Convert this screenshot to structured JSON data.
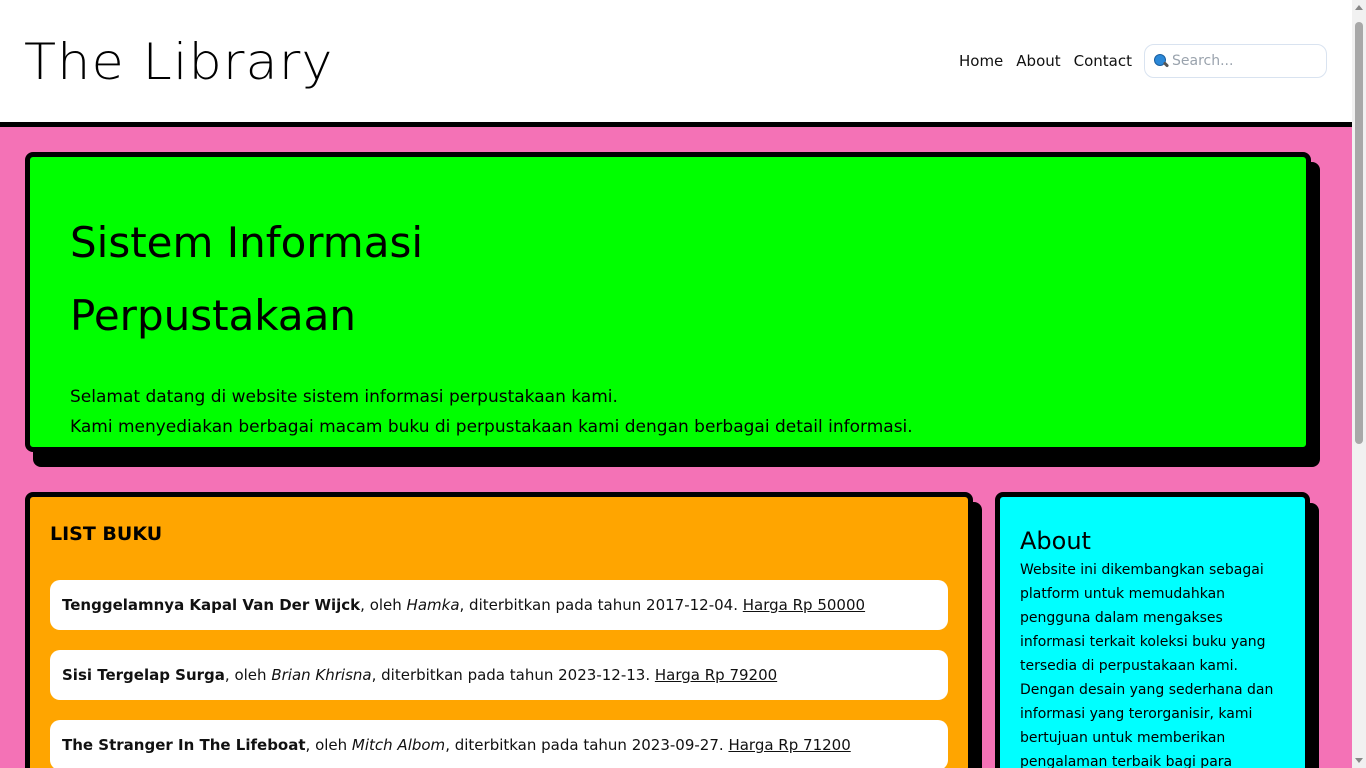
{
  "header": {
    "logo": "The Library",
    "nav": [
      "Home",
      "About",
      "Contact"
    ],
    "search_placeholder": "Search..."
  },
  "hero": {
    "title_line1": "Sistem Informasi",
    "title_line2": "Perpustakaan",
    "text_line1": "Selamat datang di website sistem informasi perpustakaan kami.",
    "text_line2": "Kami menyediakan berbagai macam buku di perpustakaan kami dengan berbagai detail informasi."
  },
  "book_list": {
    "heading": "LIST BUKU",
    "books": [
      {
        "title": "Tenggelamnya Kapal Van Der Wijck",
        "author": "Hamka",
        "date": "2017-12-04",
        "price": "Harga Rp 50000"
      },
      {
        "title": "Sisi Tergelap Surga",
        "author": "Brian Khrisna",
        "date": "2023-12-13",
        "price": "Harga Rp 79200"
      },
      {
        "title": "The Stranger In The Lifeboat",
        "author": "Mitch Albom",
        "date": "2023-09-27",
        "price": "Harga Rp 71200"
      }
    ],
    "oleh": ", oleh ",
    "published": ", diterbitkan pada tahun ",
    "dot": ". "
  },
  "about": {
    "heading": "About",
    "text": "Website ini dikembangkan sebagai platform untuk memudahkan pengguna dalam mengakses informasi terkait koleksi buku yang tersedia di perpustakaan kami. Dengan desain yang sederhana dan informasi yang terorganisir, kami bertujuan untuk memberikan pengalaman terbaik bagi para pengguna."
  },
  "colors": {
    "page_bg": "#f472b6",
    "hero_bg": "#00ff00",
    "list_bg": "#ffa500",
    "about_bg": "#00ffff"
  }
}
